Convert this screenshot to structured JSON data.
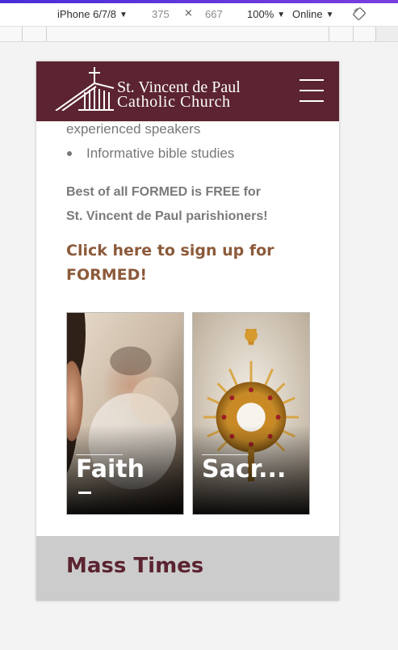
{
  "devtools": {
    "device": "iPhone 6/7/8",
    "width": "375",
    "times": "×",
    "height": "667",
    "zoom": "100%",
    "network": "Online",
    "caret": "▼"
  },
  "site": {
    "name_line1": "St. Vincent de Paul",
    "name_line2": "Catholic Church"
  },
  "content": {
    "line_speakers": "experienced speakers",
    "bullet_bible": "Informative bible studies",
    "free_line1": "Best of all FORMED is FREE for",
    "free_line2": "St. Vincent de Paul parishioners!",
    "cta_line1": "Click here to sign up for",
    "cta_line2": "FORMED!"
  },
  "cards": [
    {
      "title": "Faith"
    },
    {
      "title": "Sacr..."
    }
  ],
  "mass": {
    "title": "Mass Times"
  },
  "colors": {
    "header_bg": "#5b2430",
    "link": "#8c5a3a",
    "mass_bg": "#cccccc"
  }
}
